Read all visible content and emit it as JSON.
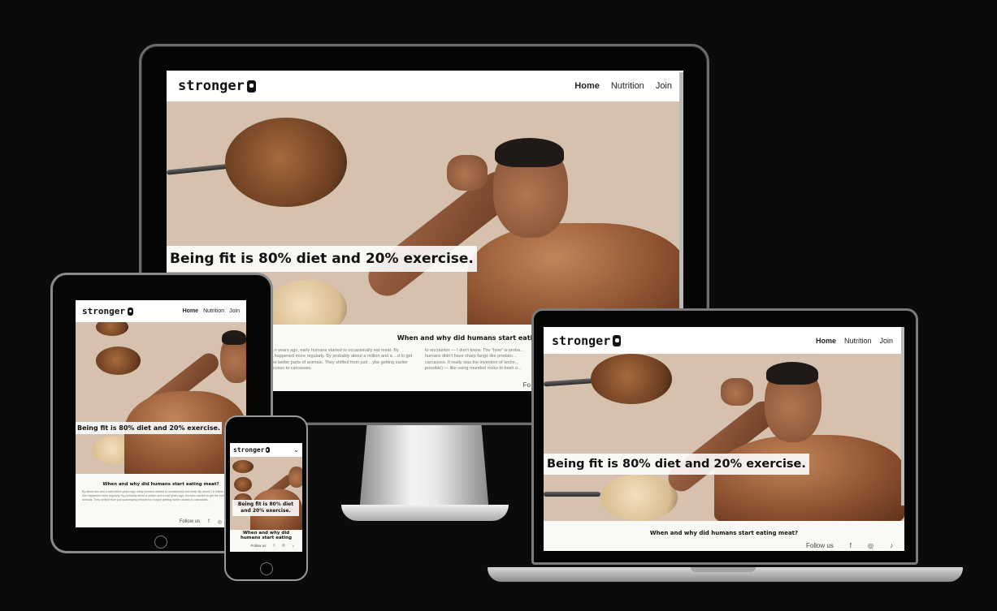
{
  "site": {
    "logo_text": "stronger",
    "nav": [
      "Home",
      "Nutrition",
      "Join"
    ],
    "hero_caption": "Being fit is 80% diet and 20% exercise.",
    "tablet_caption": "Being fit is 80% diet and 20% exercise.",
    "phone_caption": "Being fit is 80% diet and 20% exercise.",
    "article_title": "When and why did humans start eating meat?",
    "article_col1": "...n years ago, early humans started to occasionally eat meat. By ...happened more regularly. By probably about a million and a ...d to get the better parts of animals. They shifted from just ...ybe getting earlier access to carcasses.",
    "article_col2": "to encounter — I don't know. The \"how\" is proba... humans didn't have sharp fangs like predato... carcasses. It really was the invention of techn... possible) — like using rounded rocks to bash o...",
    "tablet_article": "By about two and a half million years ago, early humans started to occasionally eat meat. By about 1.5 million years ago, this happened more regularly. By probably about a million and a half years ago, humans started to get the better parts of animals. They shifted from just scavenging leftovers to maybe getting earlier access to carcasses.",
    "phone_article_title": "When and why did humans start eating meat?",
    "footer_label": "Follow us",
    "social_icons": [
      "facebook-icon",
      "instagram-icon",
      "tiktok-icon"
    ]
  },
  "glyphs": {
    "facebook": "f",
    "instagram": "◎",
    "tiktok": "♪",
    "menu": "⌄"
  },
  "colors": {
    "background": "#0c0b0b",
    "hero_bg": "#d6c1ae",
    "page_bg": "#fbf9f6"
  }
}
